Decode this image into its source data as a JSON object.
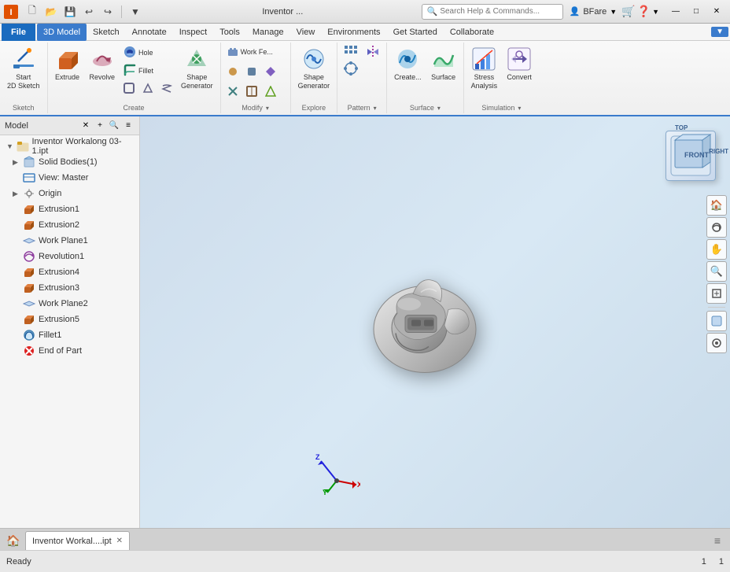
{
  "titleBar": {
    "appTitle": "Inventor ...",
    "searchPlaceholder": "Search Help & Commands...",
    "user": "BFare",
    "windowControls": [
      "—",
      "□",
      "✕"
    ]
  },
  "menuBar": {
    "fileLabel": "File",
    "items": [
      {
        "label": "3D Model",
        "active": true
      },
      {
        "label": "Sketch"
      },
      {
        "label": "Annotate"
      },
      {
        "label": "Inspect"
      },
      {
        "label": "Tools"
      },
      {
        "label": "Manage"
      },
      {
        "label": "View"
      },
      {
        "label": "Environments"
      },
      {
        "label": "Get Started"
      },
      {
        "label": "Collaborate"
      }
    ]
  },
  "ribbon": {
    "groups": [
      {
        "name": "Sketch",
        "label": "Sketch",
        "buttons": [
          {
            "icon": "✏",
            "label": "Start\n2D Sketch"
          }
        ]
      },
      {
        "name": "Create",
        "label": "Create",
        "buttons": [
          {
            "icon": "⬜",
            "label": "Extrude"
          },
          {
            "icon": "↺",
            "label": "Revolve"
          },
          {
            "icon": "⚫",
            "label": "Hole"
          },
          {
            "icon": "⌒",
            "label": "Fillet"
          },
          {
            "icon": "⬡",
            "label": "Shape\nGenerator"
          }
        ],
        "smallButtons": []
      },
      {
        "name": "Modify",
        "label": "Modify ▾",
        "smallButtons": [
          {
            "icon": "⟳",
            "label": "Work Fe..."
          },
          {
            "icon": "✦",
            "label": ""
          },
          {
            "icon": "⬢",
            "label": ""
          },
          {
            "icon": "◈",
            "label": ""
          },
          {
            "icon": "▣",
            "label": ""
          },
          {
            "icon": "⬡",
            "label": ""
          }
        ]
      },
      {
        "name": "Explore",
        "label": "Explore",
        "buttons": [
          {
            "icon": "⬡",
            "label": "Shape\nGenerator"
          }
        ]
      },
      {
        "name": "Pattern",
        "label": "Pattern ▾",
        "buttons": [
          {
            "icon": "⠿",
            "label": ""
          },
          {
            "icon": "⟲",
            "label": ""
          }
        ]
      },
      {
        "name": "Surface",
        "label": "Surface",
        "buttons": [
          {
            "icon": "◑",
            "label": "Create..."
          },
          {
            "icon": "◐",
            "label": "Surface"
          }
        ]
      },
      {
        "name": "Simulation",
        "label": "Simulation",
        "buttons": [
          {
            "icon": "📊",
            "label": "Stress\nAnalysis"
          },
          {
            "icon": "🔄",
            "label": "Convert"
          }
        ],
        "expandable": true
      }
    ]
  },
  "leftPanel": {
    "title": "Model",
    "treeItems": [
      {
        "id": "root",
        "label": "Inventor Workalong 03-1.ipt",
        "icon": "🗂",
        "indent": 0,
        "expand": true
      },
      {
        "id": "solid",
        "label": "Solid Bodies(1)",
        "icon": "📦",
        "indent": 1,
        "expand": false
      },
      {
        "id": "view",
        "label": "View: Master",
        "icon": "👁",
        "indent": 1,
        "expand": false
      },
      {
        "id": "origin",
        "label": "Origin",
        "icon": "✛",
        "indent": 1,
        "expand": false
      },
      {
        "id": "ext1",
        "label": "Extrusion1",
        "icon": "⬛",
        "indent": 1,
        "expand": false,
        "color": "orange"
      },
      {
        "id": "ext2",
        "label": "Extrusion2",
        "icon": "⬛",
        "indent": 1,
        "expand": false,
        "color": "orange"
      },
      {
        "id": "wp1",
        "label": "Work Plane1",
        "icon": "◫",
        "indent": 1,
        "expand": false
      },
      {
        "id": "rev1",
        "label": "Revolution1",
        "icon": "⟳",
        "indent": 1,
        "expand": false,
        "color": "purple"
      },
      {
        "id": "ext4",
        "label": "Extrusion4",
        "icon": "⬛",
        "indent": 1,
        "expand": false,
        "color": "orange"
      },
      {
        "id": "ext3",
        "label": "Extrusion3",
        "icon": "⬛",
        "indent": 1,
        "expand": false,
        "color": "orange"
      },
      {
        "id": "wp2",
        "label": "Work Plane2",
        "icon": "◫",
        "indent": 1,
        "expand": false
      },
      {
        "id": "ext5",
        "label": "Extrusion5",
        "icon": "⬛",
        "indent": 1,
        "expand": false,
        "color": "orange"
      },
      {
        "id": "fillet1",
        "label": "Fillet1",
        "icon": "⌒",
        "indent": 1,
        "expand": false,
        "color": "teal"
      },
      {
        "id": "endpart",
        "label": "End of Part",
        "icon": "⛔",
        "indent": 1,
        "expand": false,
        "color": "red"
      }
    ]
  },
  "viewport": {
    "navCube": {
      "front": "FRONT",
      "right": "RIGHT",
      "top": "TOP"
    },
    "navButtons": [
      "🏠",
      "🔄",
      "✋",
      "🔍",
      "↔",
      "⬛"
    ],
    "gizmo": {
      "x": "X",
      "y": "Y",
      "z": "Z"
    }
  },
  "tabBar": {
    "homeIcon": "🏠",
    "tabs": [
      {
        "label": "Inventor Workal....ipt",
        "active": true
      }
    ],
    "menuIcon": "≡"
  },
  "statusBar": {
    "text": "Ready",
    "rightValues": [
      "1",
      "1"
    ]
  }
}
